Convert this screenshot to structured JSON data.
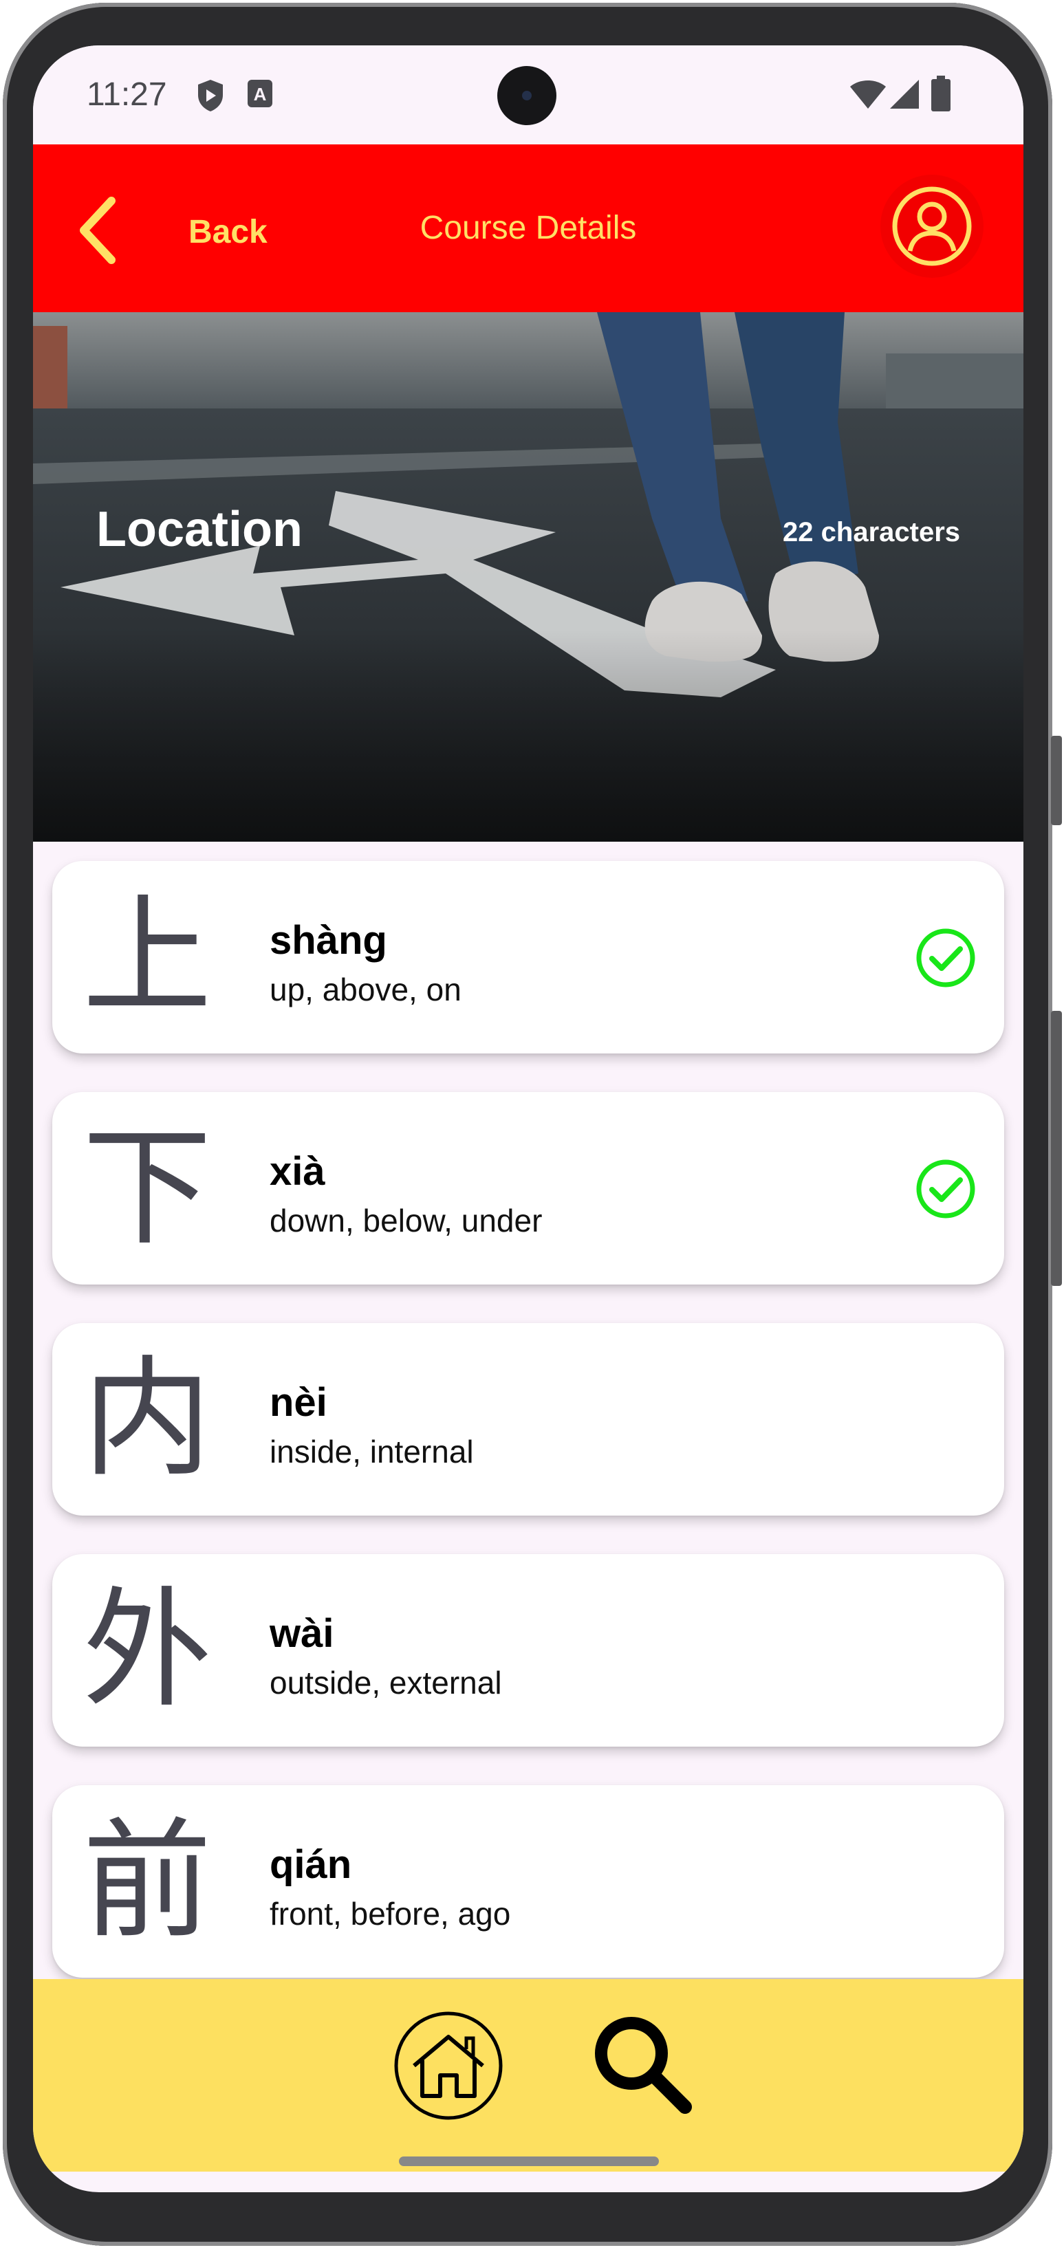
{
  "status_bar": {
    "time": "11:27",
    "icons": [
      "shield-icon",
      "text-a-icon",
      "wifi-icon",
      "signal-icon",
      "battery-icon"
    ]
  },
  "app_bar": {
    "back_label": "Back",
    "title": "Course Details",
    "colors": {
      "background": "#ff0000",
      "accent": "#ffe066"
    }
  },
  "hero": {
    "title": "Location",
    "count": "22 characters"
  },
  "characters": [
    {
      "char": "上",
      "pinyin": "shàng",
      "meaning": "up, above, on",
      "learned": true
    },
    {
      "char": "下",
      "pinyin": "xià",
      "meaning": "down, below, under",
      "learned": true
    },
    {
      "char": "内",
      "pinyin": "nèi",
      "meaning": "inside, internal",
      "learned": false
    },
    {
      "char": "外",
      "pinyin": "wài",
      "meaning": "outside, external",
      "learned": false
    },
    {
      "char": "前",
      "pinyin": "qián",
      "meaning": "front, before, ago",
      "learned": false
    }
  ],
  "bottom_nav": {
    "items": [
      "home-icon",
      "search-icon"
    ],
    "background": "#fde060"
  }
}
